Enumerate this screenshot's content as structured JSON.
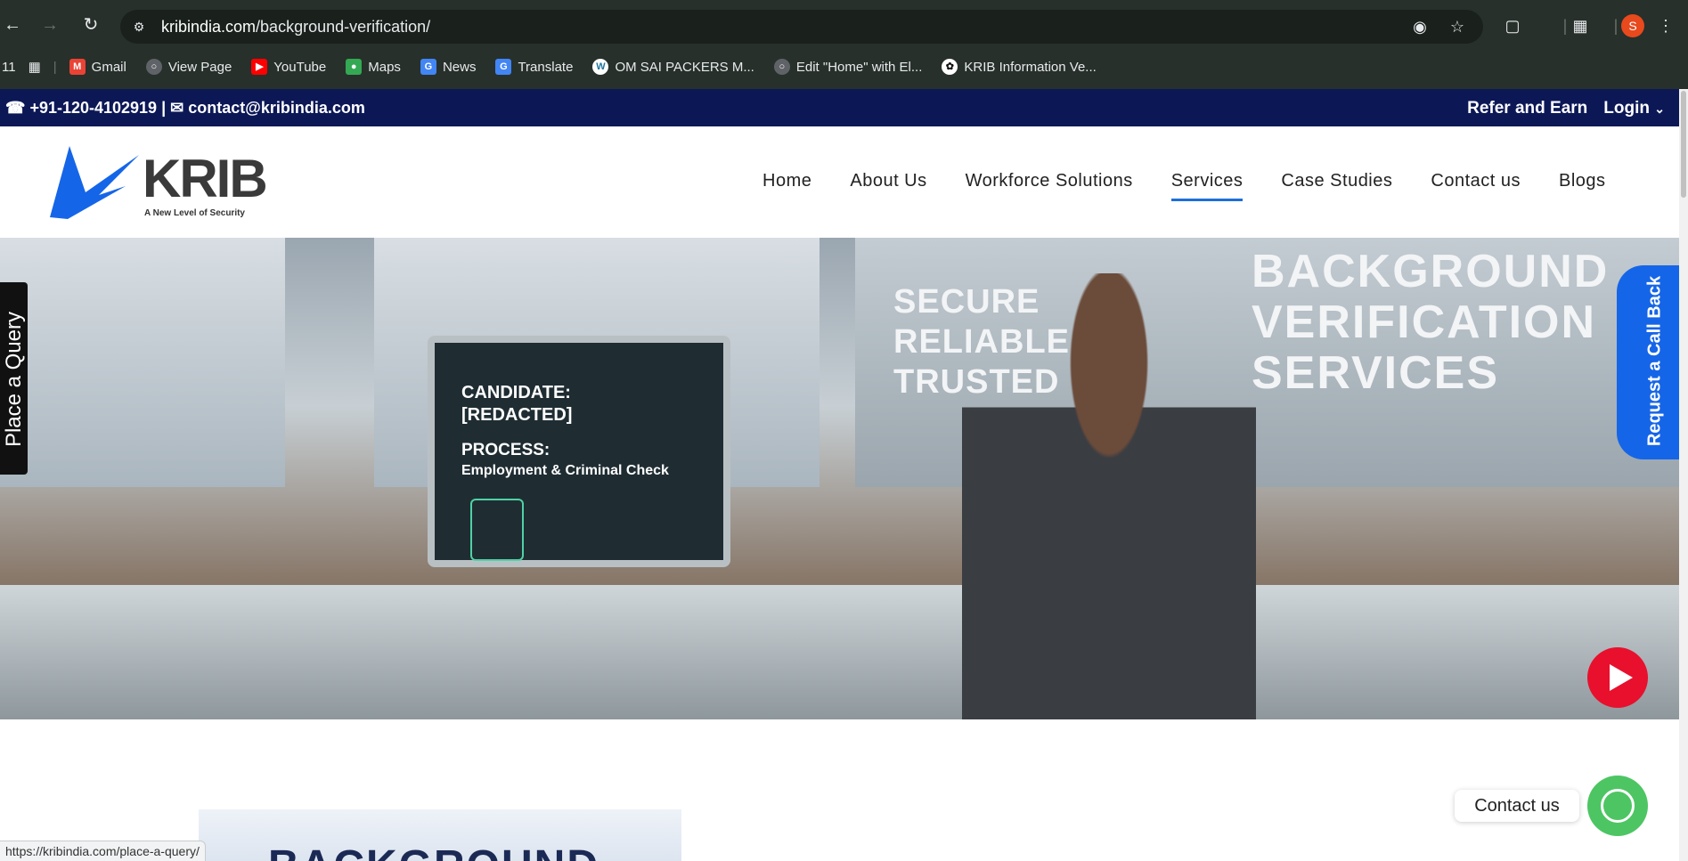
{
  "browser": {
    "url_host": "kribindia.com",
    "url_path": "/background-verification/",
    "profile_initial": "S",
    "bookmarks": [
      {
        "label": "11",
        "icon": "tab-count-icon"
      },
      {
        "label": "",
        "icon": "apps-grid-icon"
      },
      {
        "label": "Gmail",
        "icon": "gmail-icon"
      },
      {
        "label": "View Page",
        "icon": "globe-icon"
      },
      {
        "label": "YouTube",
        "icon": "youtube-icon"
      },
      {
        "label": "Maps",
        "icon": "maps-icon"
      },
      {
        "label": "News",
        "icon": "news-icon"
      },
      {
        "label": "Translate",
        "icon": "translate-icon"
      },
      {
        "label": "OM SAI PACKERS M...",
        "icon": "wordpress-icon"
      },
      {
        "label": "Edit \"Home\" with El...",
        "icon": "globe-icon"
      },
      {
        "label": "KRIB Information Ve...",
        "icon": "openai-icon"
      }
    ],
    "status_url": "https://kribindia.com/place-a-query/"
  },
  "topbar": {
    "phone": "+91-120-4102919",
    "separator": "|",
    "email": "contact@kribindia.com",
    "refer": "Refer and Earn",
    "login": "Login"
  },
  "header": {
    "logo_word": "KRIB",
    "logo_tagline": "A New Level of Security",
    "menu": [
      "Home",
      "About Us",
      "Workforce Solutions",
      "Services",
      "Case Studies",
      "Contact us",
      "Blogs"
    ],
    "active_menu": "Services"
  },
  "hero": {
    "monitor_candidate_label": "CANDIDATE:",
    "monitor_candidate_value": "[REDACTED]",
    "monitor_process_label": "PROCESS:",
    "monitor_process_value": "Employment & Criminal Check",
    "slogan": [
      "SECURE",
      "RELIABLE",
      "TRUSTED"
    ],
    "headline": [
      "BACKGROUND",
      "VERIFICATION",
      "SERVICES"
    ]
  },
  "floating": {
    "place_query": "Place a Query",
    "callback": "Request a Call Back",
    "contact_us": "Contact us"
  },
  "content": {
    "thumb_text": "BACKGROUND"
  },
  "colors": {
    "topbar_bg": "#0c1856",
    "accent_blue": "#1565e8",
    "whatsapp": "#4dc563",
    "youtube_red": "#e8102d"
  }
}
